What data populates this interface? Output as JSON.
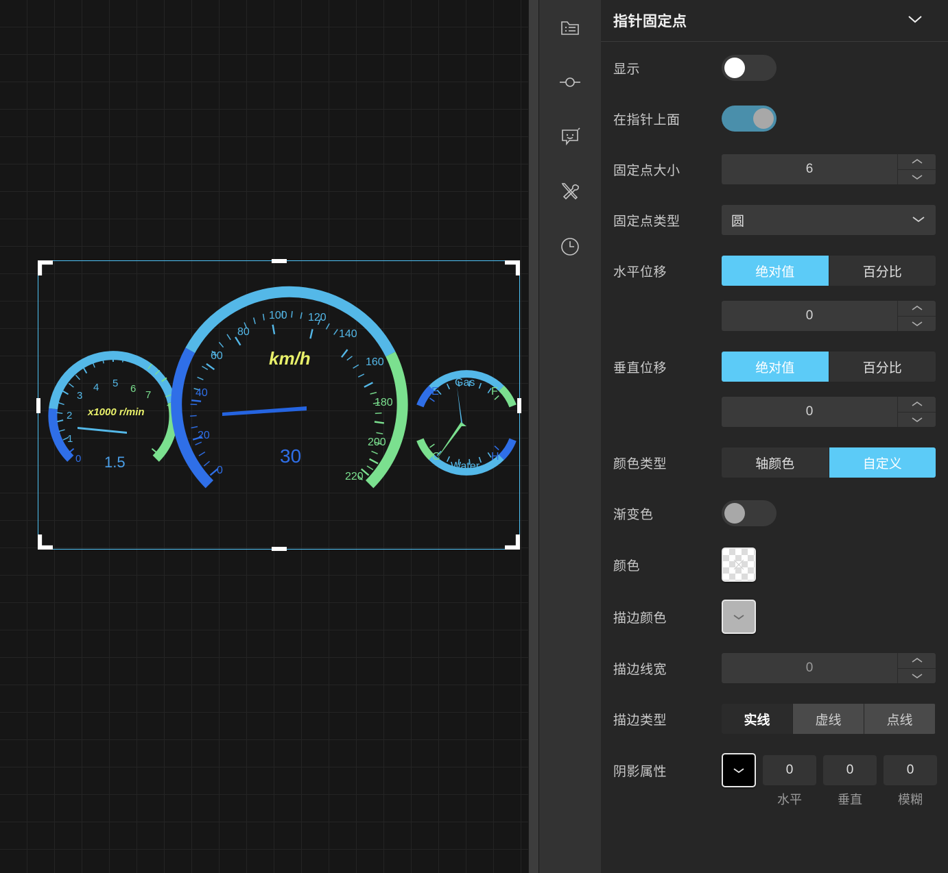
{
  "panel": {
    "header_title": "指针固定点",
    "collapse_icon": "chevron-down-icon",
    "rows": {
      "show": {
        "label": "显示",
        "state": "off"
      },
      "above_pointer": {
        "label": "在指针上面",
        "state": "on"
      },
      "point_size": {
        "label": "固定点大小",
        "value": "6"
      },
      "point_type": {
        "label": "固定点类型",
        "value": "圆"
      },
      "offset_x": {
        "label": "水平位移",
        "seg": [
          "绝对值",
          "百分比"
        ],
        "active": 0,
        "value": "0"
      },
      "offset_y": {
        "label": "垂直位移",
        "seg": [
          "绝对值",
          "百分比"
        ],
        "active": 0,
        "value": "0"
      },
      "color_type": {
        "label": "颜色类型",
        "seg": [
          "轴颜色",
          "自定义"
        ],
        "active": 1
      },
      "gradient": {
        "label": "渐变色",
        "state": "off"
      },
      "color": {
        "label": "颜色",
        "swatch": "transparent"
      },
      "stroke_color": {
        "label": "描边颜色",
        "swatch": "gray"
      },
      "stroke_width": {
        "label": "描边线宽",
        "value": "0"
      },
      "stroke_type": {
        "label": "描边类型",
        "seg": [
          "实线",
          "虚线",
          "点线"
        ],
        "active": 0
      },
      "shadow": {
        "label": "阴影属性",
        "swatch": "black",
        "values": [
          "0",
          "0",
          "0"
        ],
        "sub_labels": [
          "水平",
          "垂直",
          "模糊"
        ]
      }
    }
  },
  "iconbar": {
    "items": [
      {
        "name": "folder-list-icon"
      },
      {
        "name": "node-connector-icon"
      },
      {
        "name": "chat-smiley-icon"
      },
      {
        "name": "tools-icon"
      },
      {
        "name": "clock-icon"
      }
    ]
  },
  "colors": {
    "accent": "#5ccbf7",
    "toggle_on": "#4a8fab",
    "panel_bg": "#262626",
    "canvas_bg": "#161616",
    "selection": "#4fc3f7",
    "gauge_blue": "#2f6fe8",
    "gauge_lightblue": "#54b8e8",
    "gauge_green": "#7be08f",
    "gauge_yellow": "#e8f06a"
  },
  "chart_data": {
    "type": "gauge",
    "title": "",
    "gauges": [
      {
        "name": "rpm",
        "unit_label": "x1000 r/min",
        "unit_color": "#e8f06a",
        "value": 1.5,
        "value_text": "1.5",
        "value_color": "#2f6fe8",
        "min": 0,
        "max": 7,
        "tick_labels": [
          "0",
          "1",
          "2",
          "3",
          "4",
          "5",
          "6",
          "7"
        ],
        "bands": [
          {
            "from": 0,
            "to": 1,
            "color": "#2f6fe8"
          },
          {
            "from": 1,
            "to": 5.5,
            "color": "#54b8e8"
          },
          {
            "from": 5.5,
            "to": 7,
            "color": "#7be08f"
          }
        ],
        "start_angle": 225,
        "end_angle": -45
      },
      {
        "name": "speed",
        "unit_label": "km/h",
        "unit_color": "#e8f06a",
        "value": 30,
        "value_text": "30",
        "value_color": "#2f6fe8",
        "min": 0,
        "max": 220,
        "tick_labels": [
          "0",
          "20",
          "40",
          "60",
          "80",
          "100",
          "120",
          "140",
          "160",
          "180",
          "200",
          "220"
        ],
        "bands": [
          {
            "from": 0,
            "to": 45,
            "color": "#2f6fe8"
          },
          {
            "from": 45,
            "to": 170,
            "color": "#54b8e8"
          },
          {
            "from": 170,
            "to": 220,
            "color": "#7be08f"
          }
        ],
        "start_angle": 225,
        "end_angle": -45
      },
      {
        "name": "gas",
        "unit_label": "Gas",
        "unit_color": "#54b8e8",
        "min_label": "E",
        "max_label": "F",
        "min_label_color": "#2f6fe8",
        "max_label_color": "#7be08f",
        "value": 0.5,
        "bands": [
          {
            "from": 0,
            "to": 0.2,
            "color": "#2f6fe8"
          },
          {
            "from": 0.2,
            "to": 0.8,
            "color": "#54b8e8"
          },
          {
            "from": 0.8,
            "to": 1,
            "color": "#7be08f"
          }
        ]
      },
      {
        "name": "water",
        "unit_label": "Water",
        "unit_color": "#54b8e8",
        "min_label": "C",
        "max_label": "H",
        "min_label_color": "#7be08f",
        "max_label_color": "#2f6fe8",
        "value": 0.35,
        "bands": [
          {
            "from": 0,
            "to": 0.2,
            "color": "#7be08f"
          },
          {
            "from": 0.2,
            "to": 0.8,
            "color": "#54b8e8"
          },
          {
            "from": 0.8,
            "to": 1,
            "color": "#2f6fe8"
          }
        ]
      }
    ]
  }
}
